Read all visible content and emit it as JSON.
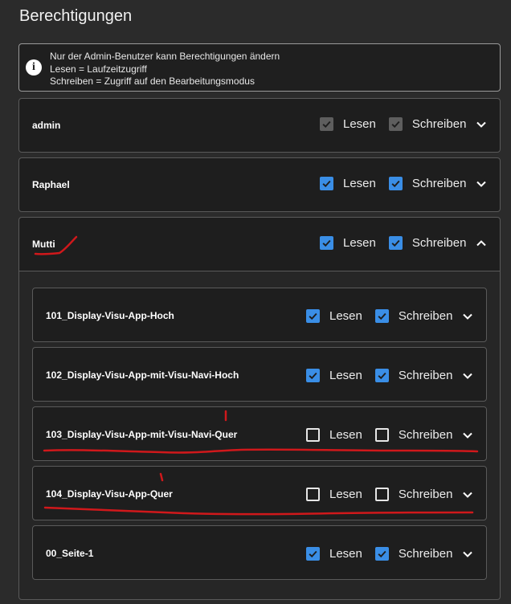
{
  "title": "Berechtigungen",
  "info": {
    "lines": [
      "Nur der Admin-Benutzer kann Berechtigungen ändern",
      "Lesen = Laufzeitzugriff",
      "Schreiben = Zugriff auf den Bearbeitungsmodus"
    ]
  },
  "labels": {
    "read": "Lesen",
    "write": "Schreiben"
  },
  "users": [
    {
      "name": "admin",
      "read": "checked-disabled",
      "write": "checked-disabled",
      "expanded": false
    },
    {
      "name": "Raphael",
      "read": "checked",
      "write": "checked",
      "expanded": false
    },
    {
      "name": "Mutti",
      "read": "checked",
      "write": "checked",
      "expanded": true
    }
  ],
  "pages": [
    {
      "name": "101_Display-Visu-App-Hoch",
      "read": true,
      "write": true
    },
    {
      "name": "102_Display-Visu-App-mit-Visu-Navi-Hoch",
      "read": true,
      "write": true
    },
    {
      "name": "103_Display-Visu-App-mit-Visu-Navi-Quer",
      "read": false,
      "write": false
    },
    {
      "name": "104_Display-Visu-App-Quer",
      "read": false,
      "write": false
    },
    {
      "name": "00_Seite-1",
      "read": true,
      "write": true
    }
  ],
  "colors": {
    "accent": "#3a8ee6",
    "annotation": "#d0181b",
    "panel": "#1e1e1e",
    "background": "#2b2b2b"
  }
}
